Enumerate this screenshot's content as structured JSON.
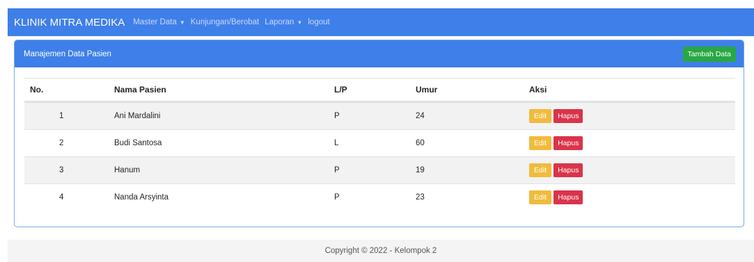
{
  "navbar": {
    "brand": "KLINIK MITRA MEDIKA",
    "items": [
      {
        "label": "Master Data",
        "dropdown": true
      },
      {
        "label": "Kunjungan/Berobat",
        "dropdown": false
      },
      {
        "label": "Laporan",
        "dropdown": true
      },
      {
        "label": "logout",
        "dropdown": false
      }
    ],
    "color": "#3f7fe9"
  },
  "card": {
    "title": "Manajemen Data Pasien",
    "add_button": "Tambah Data"
  },
  "table": {
    "headers": [
      "No.",
      "Nama Pasien",
      "L/P",
      "Umur",
      "Aksi"
    ],
    "rows": [
      {
        "no": "1",
        "name": "Ani Mardalini",
        "lp": "P",
        "umur": "24"
      },
      {
        "no": "2",
        "name": "Budi Santosa",
        "lp": "L",
        "umur": "60"
      },
      {
        "no": "3",
        "name": "Hanum",
        "lp": "P",
        "umur": "19"
      },
      {
        "no": "4",
        "name": "Nanda Arsyinta",
        "lp": "P",
        "umur": "23"
      }
    ],
    "edit_label": "Edit",
    "delete_label": "Hapus"
  },
  "footer": {
    "text": "Copyright © 2022 - Kelompok 2"
  }
}
